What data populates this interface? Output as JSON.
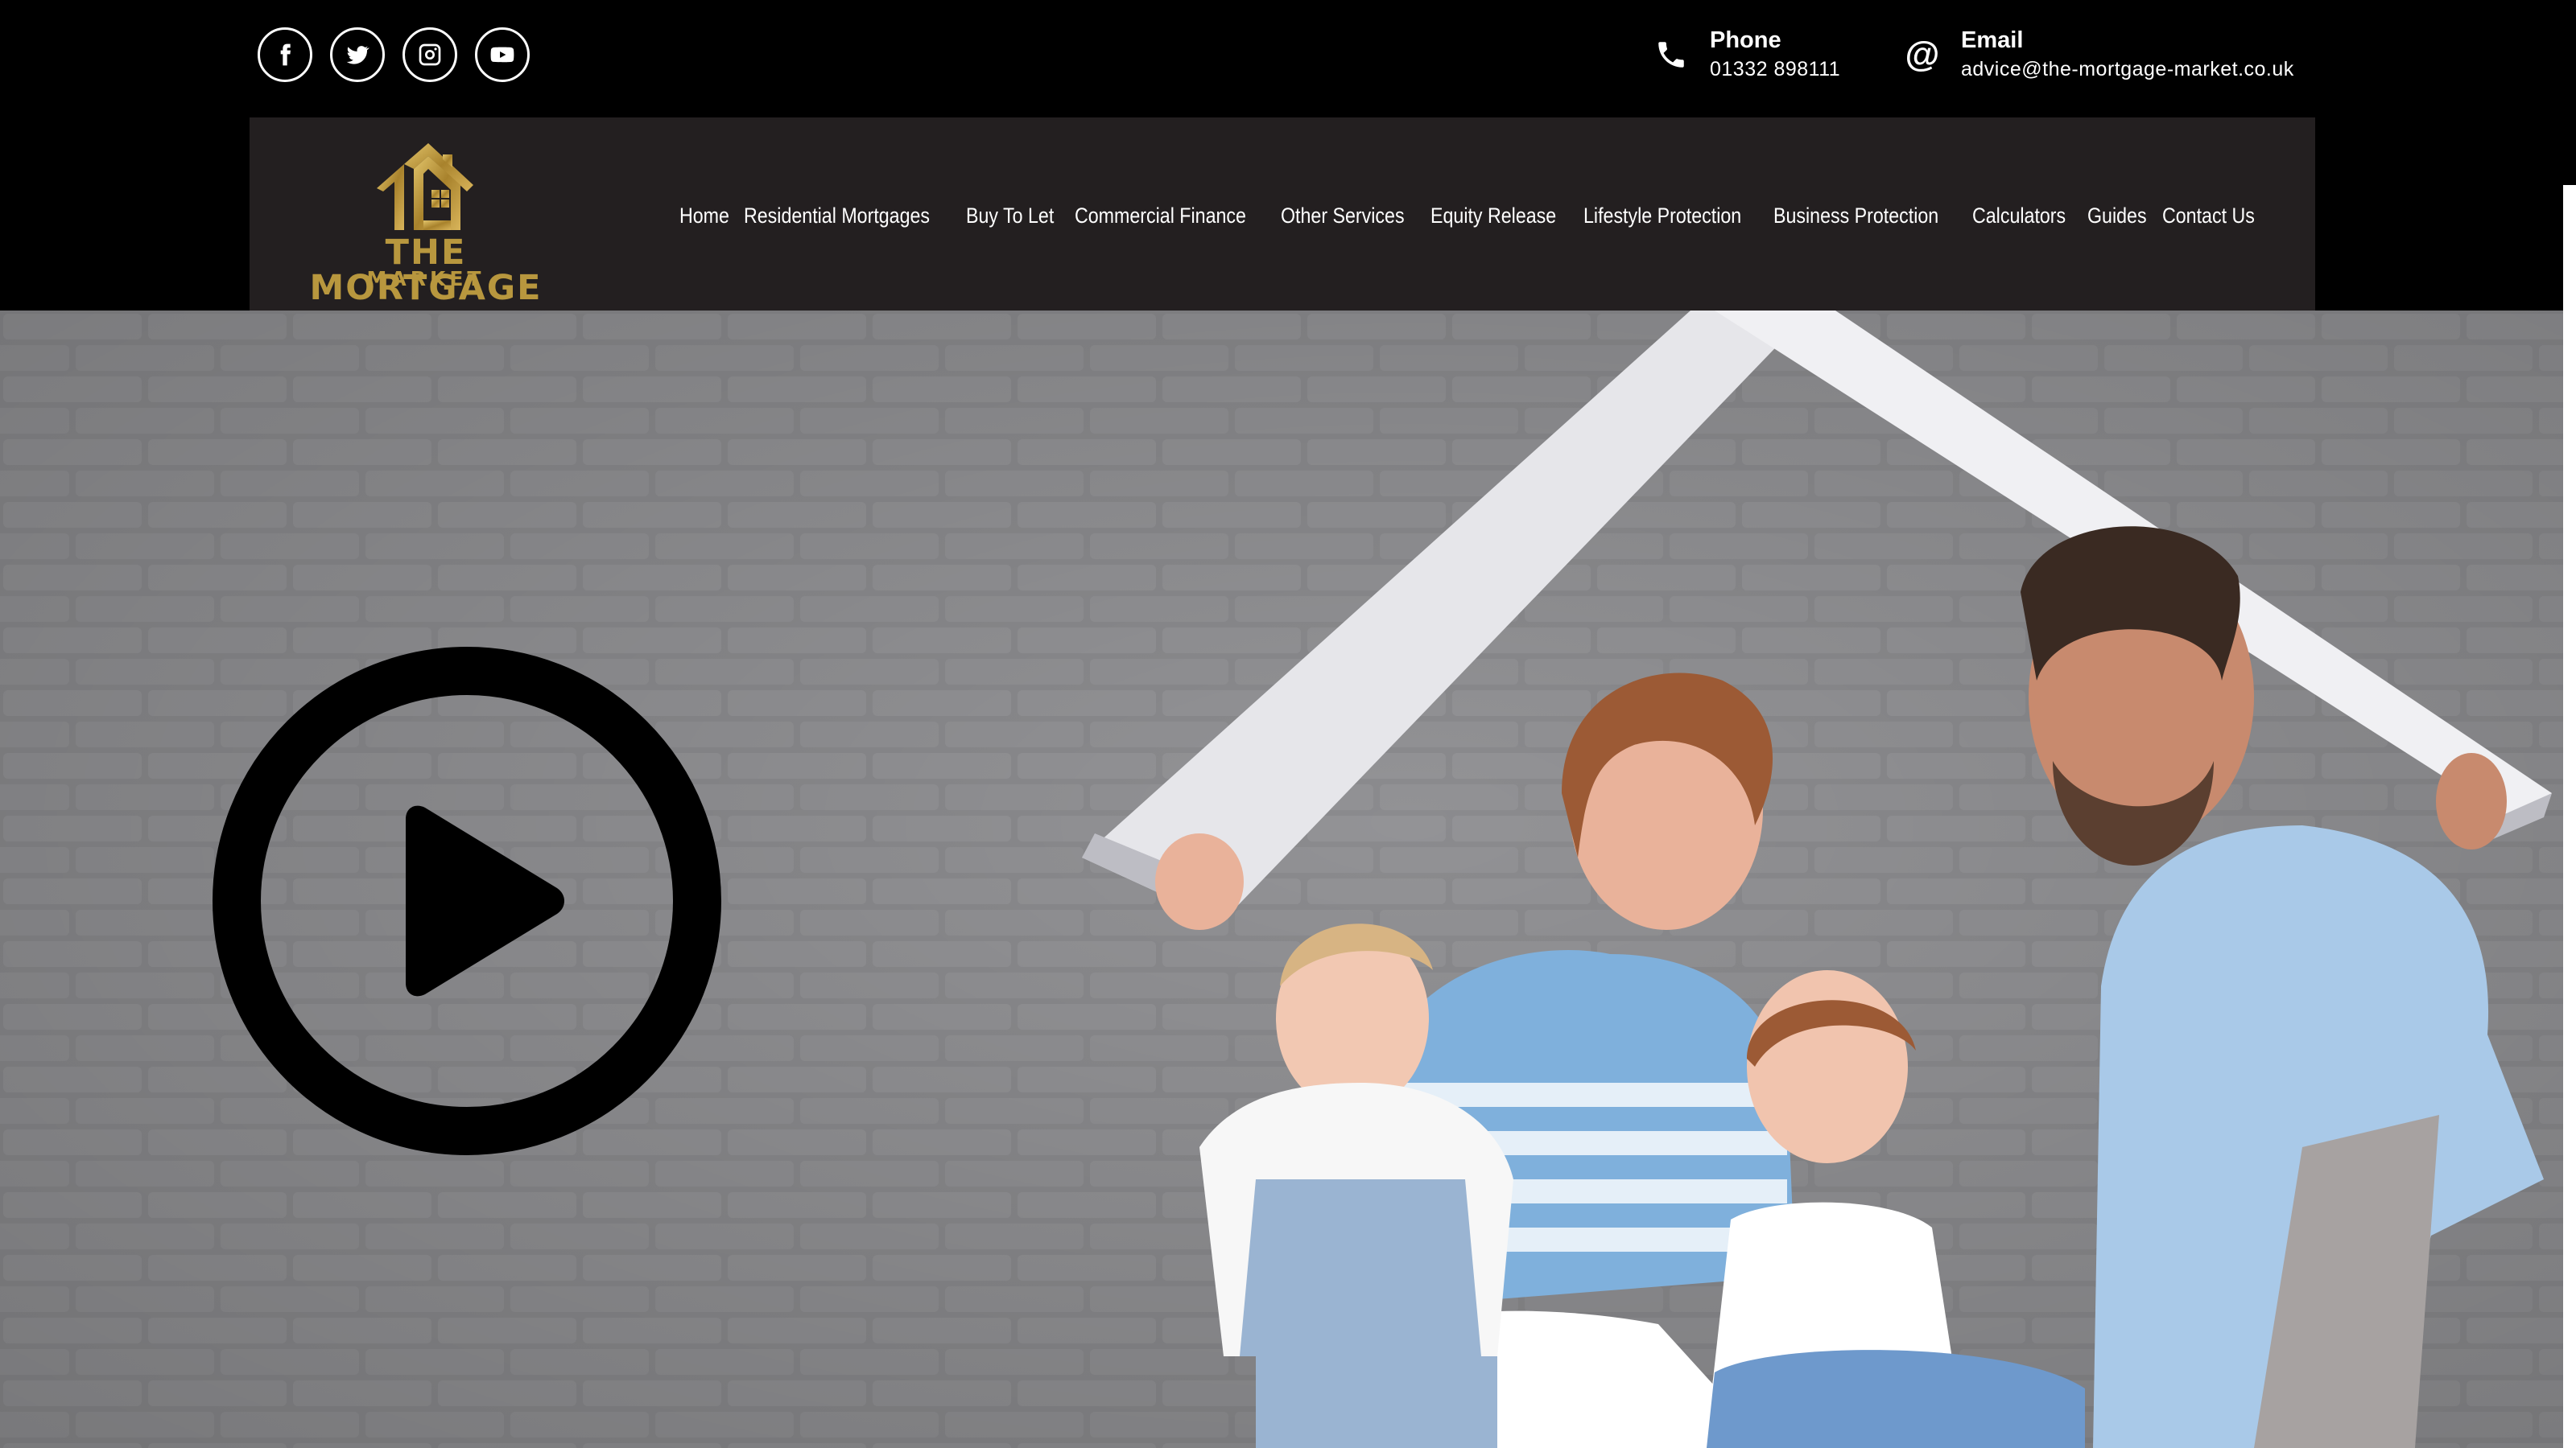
{
  "topbar": {
    "socials": [
      {
        "name": "facebook-icon",
        "glyph": "f"
      },
      {
        "name": "twitter-icon",
        "glyph": "t"
      },
      {
        "name": "instagram-icon",
        "glyph": "i"
      },
      {
        "name": "youtube-icon",
        "glyph": "y"
      }
    ],
    "phone": {
      "title": "Phone",
      "value": "01332 898111"
    },
    "email": {
      "title": "Email",
      "value": "advice@the-mortgage-market.co.uk"
    }
  },
  "logo": {
    "line1": "THE MORTGAGE",
    "line2": "MARKET",
    "color": "#b8973e"
  },
  "nav": {
    "items": [
      "Home",
      "Residential Mortgages",
      "Buy To Let",
      "Commercial Finance",
      "Other Services",
      "Equity Release",
      "Lifestyle Protection",
      "Business Protection",
      "Calculators",
      "Guides",
      "Contact Us"
    ]
  },
  "hero": {
    "play_icon": "play-circle-icon"
  },
  "colors": {
    "topbar": "#000000",
    "navbar": "#231f20",
    "accent": "#b8973e",
    "hero_bg": "#8a8a8d"
  }
}
